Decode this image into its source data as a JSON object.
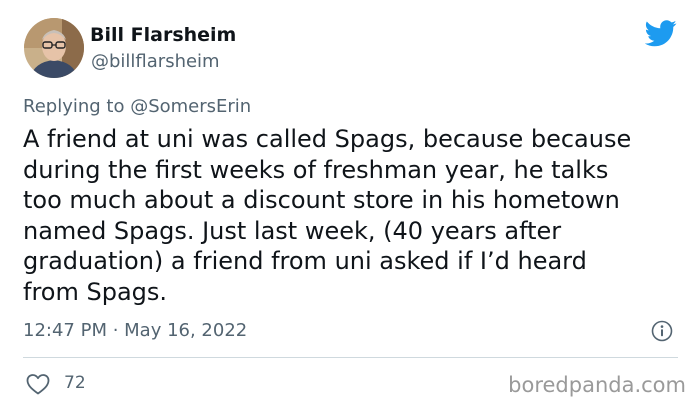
{
  "author": {
    "display_name": "Bill Flarsheim",
    "handle": "@billflarsheim",
    "avatar": "profile-photo"
  },
  "platform_icon": "twitter-bird-icon",
  "reply": {
    "prefix": "Replying to ",
    "mention": "@SomersErin"
  },
  "tweet": {
    "text": "A friend at uni was called Spags, because because\nduring the first weeks of freshman year, he talks\ntoo much about a discount store in his hometown\nnamed Spags. Just last week, (40 years after\ngraduation) a friend from uni asked if I’d heard\nfrom Spags.",
    "timestamp": "12:47 PM · May 16, 2022"
  },
  "engagement": {
    "like_icon": "heart-icon",
    "like_count": "72"
  },
  "info_icon": "info-icon",
  "watermark": "boredpanda.com",
  "colors": {
    "twitter_blue": "#1d9bf0",
    "text_primary": "#0f1419",
    "text_secondary": "#536471",
    "divider": "#cfd9de",
    "watermark": "#9a9a9a"
  }
}
